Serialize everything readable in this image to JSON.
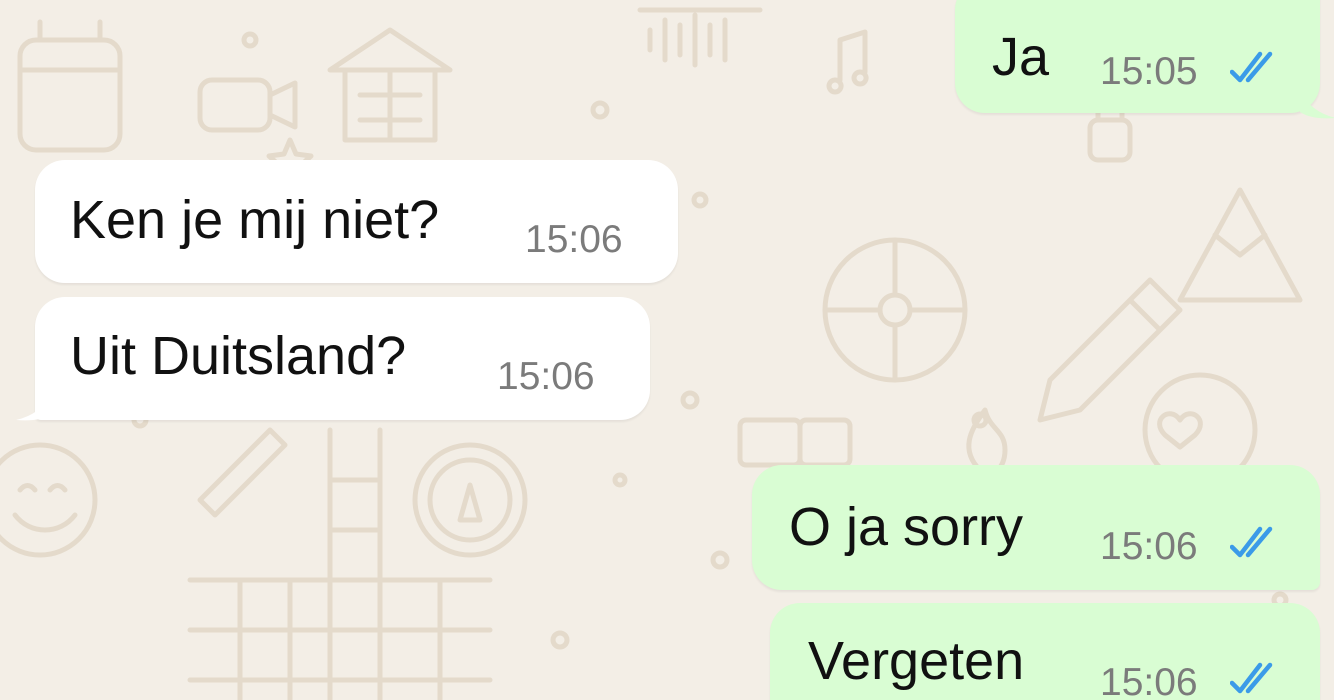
{
  "colors": {
    "background": "#f3eee6",
    "wallpaper_doodle": "#e4dacb",
    "outgoing_bubble": "#d9fdd3",
    "incoming_bubble": "#ffffff",
    "read_ticks": "#3b9be8",
    "timestamp": "#7b7b7b",
    "message_text": "#111111"
  },
  "messages": [
    {
      "direction": "outgoing",
      "text": "Ja",
      "time": "15:05",
      "status_icon": "double-check-read-icon"
    },
    {
      "direction": "incoming",
      "text": "Ken je mij niet?",
      "time": "15:06"
    },
    {
      "direction": "incoming",
      "text": "Uit Duitsland?",
      "time": "15:06"
    },
    {
      "direction": "outgoing",
      "text": "O ja sorry",
      "time": "15:06",
      "status_icon": "double-check-read-icon"
    },
    {
      "direction": "outgoing",
      "text": "Vergeten",
      "time": "15:06",
      "status_icon": "double-check-read-icon"
    }
  ]
}
